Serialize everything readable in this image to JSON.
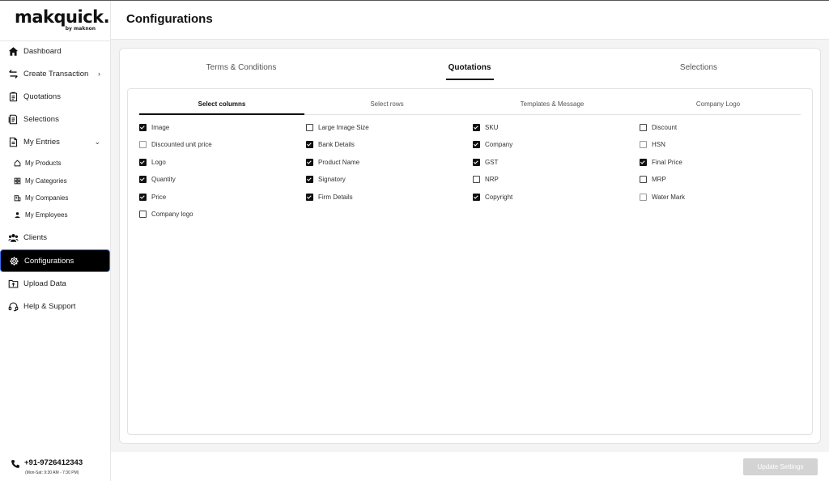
{
  "brand": {
    "name": "makquick.",
    "sub": "by maknon"
  },
  "sidebar": {
    "items": [
      {
        "label": "Dashboard",
        "icon": "home-icon"
      },
      {
        "label": "Create Transaction",
        "icon": "transfer-icon"
      },
      {
        "label": "Quotations",
        "icon": "clipboard-icon"
      },
      {
        "label": "Selections",
        "icon": "document-icon"
      },
      {
        "label": "My Entries",
        "icon": "file-icon"
      }
    ],
    "subitems": [
      {
        "label": "My Products",
        "icon": "home-icon"
      },
      {
        "label": "My Categories",
        "icon": "grid-icon"
      },
      {
        "label": "My Companies",
        "icon": "building-icon"
      },
      {
        "label": "My Employees",
        "icon": "person-icon"
      }
    ],
    "items2": [
      {
        "label": "Clients",
        "icon": "people-icon"
      },
      {
        "label": "Configurations",
        "icon": "gear-icon",
        "active": true
      },
      {
        "label": "Upload Data",
        "icon": "upload-icon"
      },
      {
        "label": "Help & Support",
        "icon": "headset-icon"
      }
    ],
    "phone": "+91-9726412343",
    "hours": "(Mon-Sat: 9:30 AM - 7:30 PM)"
  },
  "header": {
    "title": "Configurations"
  },
  "tabs": [
    {
      "label": "Terms & Conditions"
    },
    {
      "label": "Quotations",
      "active": true
    },
    {
      "label": "Selections"
    }
  ],
  "subtabs": [
    {
      "label": "Select columns",
      "active": true
    },
    {
      "label": "Select rows"
    },
    {
      "label": "Templates & Message"
    },
    {
      "label": "Company Logo"
    }
  ],
  "columns": [
    [
      {
        "label": "Image",
        "checked": true
      },
      {
        "label": "Discounted unit price",
        "checked": false
      },
      {
        "label": "Logo",
        "checked": true
      },
      {
        "label": "Quantity",
        "checked": true
      },
      {
        "label": "Price",
        "checked": true
      },
      {
        "label": "Company logo",
        "checked": false
      }
    ],
    [
      {
        "label": "Large Image Size",
        "checked": false
      },
      {
        "label": "Bank Details",
        "checked": true
      },
      {
        "label": "Product Name",
        "checked": true
      },
      {
        "label": "Signatory",
        "checked": true
      },
      {
        "label": "Firm Details",
        "checked": true
      }
    ],
    [
      {
        "label": "SKU",
        "checked": true
      },
      {
        "label": "Company",
        "checked": true
      },
      {
        "label": "GST",
        "checked": true
      },
      {
        "label": "NRP",
        "checked": false
      },
      {
        "label": "Copyright",
        "checked": true
      }
    ],
    [
      {
        "label": "Discount",
        "checked": false
      },
      {
        "label": "HSN",
        "checked": false
      },
      {
        "label": "Final Price",
        "checked": true
      },
      {
        "label": "MRP",
        "checked": false
      },
      {
        "label": "Water Mark",
        "checked": false
      }
    ]
  ],
  "footer": {
    "update_label": "Update Settings"
  },
  "colors": {
    "active_bg": "#000000",
    "active_border": "#3a6df0",
    "button_disabled": "#d3d3d3"
  }
}
